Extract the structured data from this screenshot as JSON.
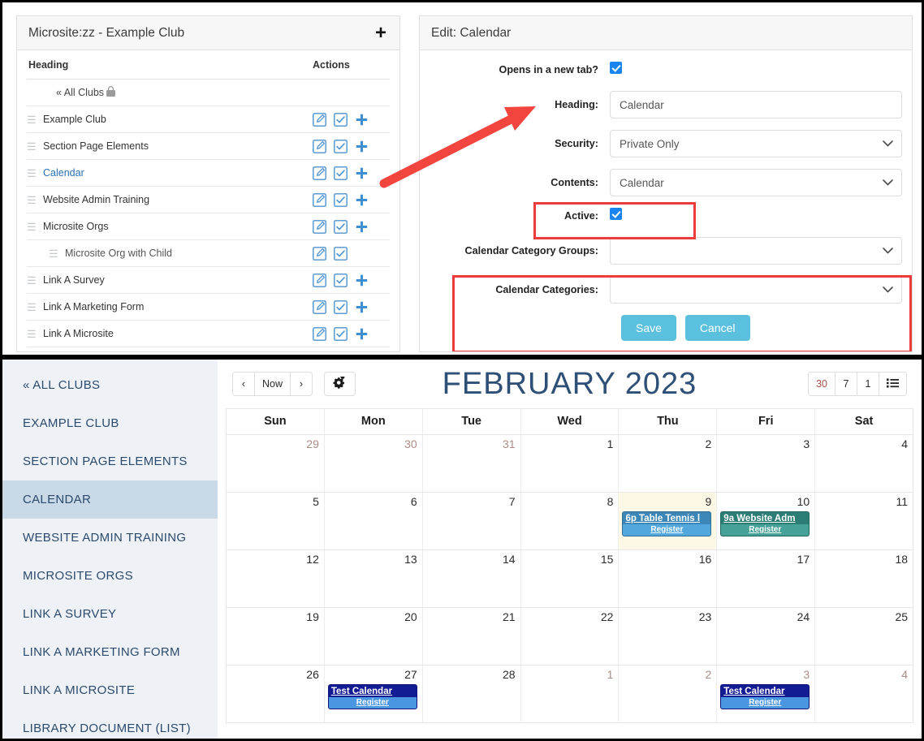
{
  "admin": {
    "left_panel": {
      "title": "Microsite:zz - Example Club",
      "add_label": "+",
      "columns": {
        "heading": "Heading",
        "actions": "Actions"
      },
      "back_link": "« All Clubs",
      "rows": [
        {
          "label": "Example Club",
          "link": false,
          "child": false,
          "has_add": true
        },
        {
          "label": "Section Page Elements",
          "link": false,
          "child": false,
          "has_add": true
        },
        {
          "label": "Calendar",
          "link": true,
          "child": false,
          "has_add": true
        },
        {
          "label": "Website Admin Training",
          "link": false,
          "child": false,
          "has_add": true
        },
        {
          "label": "Microsite Orgs",
          "link": false,
          "child": false,
          "has_add": true
        },
        {
          "label": "Microsite Org with Child",
          "link": false,
          "child": true,
          "has_add": false
        },
        {
          "label": "Link A Survey",
          "link": false,
          "child": false,
          "has_add": true
        },
        {
          "label": "Link A Marketing Form",
          "link": false,
          "child": false,
          "has_add": true
        },
        {
          "label": "Link A Microsite",
          "link": false,
          "child": false,
          "has_add": true
        }
      ]
    },
    "right_panel": {
      "title": "Edit: Calendar",
      "fields": {
        "new_tab_label": "Opens in a new tab?",
        "new_tab_checked": true,
        "heading_label": "Heading:",
        "heading_value": "Calendar",
        "security_label": "Security:",
        "security_value": "Private Only",
        "contents_label": "Contents:",
        "contents_value": "Calendar",
        "active_label": "Active:",
        "active_checked": true,
        "cal_groups_label": "Calendar Category Groups:",
        "cal_groups_value": "",
        "cal_categories_label": "Calendar Categories:",
        "cal_categories_value": ""
      },
      "save_label": "Save",
      "cancel_label": "Cancel"
    },
    "annotation_color": "#ef3b3b"
  },
  "calendar_page": {
    "sidebar": [
      {
        "label": "« ALL CLUBS",
        "active": false
      },
      {
        "label": "EXAMPLE CLUB",
        "active": false
      },
      {
        "label": "SECTION PAGE ELEMENTS",
        "active": false
      },
      {
        "label": "CALENDAR",
        "active": true
      },
      {
        "label": "WEBSITE ADMIN TRAINING",
        "active": false
      },
      {
        "label": "MICROSITE ORGS",
        "active": false
      },
      {
        "label": "LINK A SURVEY",
        "active": false
      },
      {
        "label": "LINK A MARKETING FORM",
        "active": false
      },
      {
        "label": "LINK A MICROSITE",
        "active": false
      },
      {
        "label": "LIBRARY DOCUMENT (LIST)",
        "active": false
      }
    ],
    "toolbar": {
      "prev_label": "‹",
      "now_label": "Now",
      "next_label": "›",
      "settings_icon": "cogs-icon",
      "view_30": "30",
      "view_7": "7",
      "view_1": "1",
      "view_list_icon": "list-icon",
      "active_view": "30"
    },
    "title": "FEBRUARY 2023",
    "dow": [
      "Sun",
      "Mon",
      "Tue",
      "Wed",
      "Thu",
      "Fri",
      "Sat"
    ],
    "weeks": [
      [
        {
          "n": "29",
          "other": true
        },
        {
          "n": "30",
          "other": true
        },
        {
          "n": "31",
          "other": true
        },
        {
          "n": "1"
        },
        {
          "n": "2"
        },
        {
          "n": "3"
        },
        {
          "n": "4"
        }
      ],
      [
        {
          "n": "5"
        },
        {
          "n": "6"
        },
        {
          "n": "7"
        },
        {
          "n": "8"
        },
        {
          "n": "9",
          "today": true,
          "events": [
            {
              "title": "6p Table Tennis l",
              "register": "Register",
              "color": "#3d87b8",
              "reg_color": "#52a8dd"
            }
          ]
        },
        {
          "n": "10",
          "events": [
            {
              "title": "9a Website Adm",
              "register": "Register",
              "color": "#2b7d75",
              "reg_color": "#46a198"
            }
          ]
        },
        {
          "n": "11"
        }
      ],
      [
        {
          "n": "12"
        },
        {
          "n": "13"
        },
        {
          "n": "14"
        },
        {
          "n": "15"
        },
        {
          "n": "16"
        },
        {
          "n": "17"
        },
        {
          "n": "18"
        }
      ],
      [
        {
          "n": "19"
        },
        {
          "n": "20"
        },
        {
          "n": "21"
        },
        {
          "n": "22"
        },
        {
          "n": "23"
        },
        {
          "n": "24"
        },
        {
          "n": "25"
        }
      ],
      [
        {
          "n": "26"
        },
        {
          "n": "27",
          "events": [
            {
              "title": "Test Calendar",
              "register": "Register",
              "color": "#141c94",
              "reg_color": "#4b96e0"
            }
          ]
        },
        {
          "n": "28"
        },
        {
          "n": "1",
          "other": true
        },
        {
          "n": "2",
          "other": true
        },
        {
          "n": "3",
          "other": true,
          "events": [
            {
              "title": "Test Calendar",
              "register": "Register",
              "color": "#141c94",
              "reg_color": "#4b96e0"
            }
          ]
        },
        {
          "n": "4",
          "other": true
        }
      ]
    ]
  }
}
